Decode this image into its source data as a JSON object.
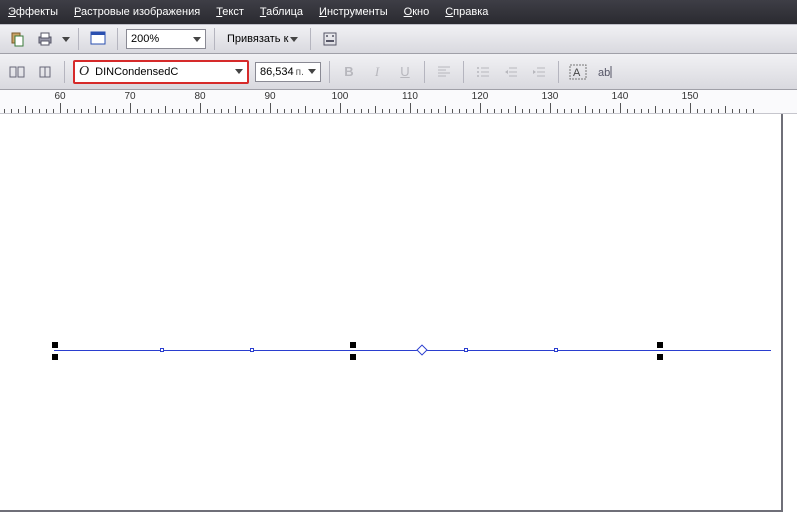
{
  "menu": {
    "effects": {
      "u": "Э",
      "rest": "ффекты"
    },
    "raster": {
      "u": "Р",
      "rest": "астровые изображения"
    },
    "text": {
      "u": "Т",
      "rest": "екст"
    },
    "table": {
      "u": "Т",
      "rest": "аблица"
    },
    "tools": {
      "u": "И",
      "rest": "нструменты"
    },
    "window": {
      "u": "О",
      "rest": "кно"
    },
    "help": {
      "u": "С",
      "rest": "правка"
    }
  },
  "toolbar1": {
    "zoom": "200%",
    "snap_label": "Привязать к"
  },
  "toolbar2": {
    "font_name": "DINCondensedC",
    "font_size": "86,534",
    "size_unit": "п."
  },
  "ruler": {
    "labels": [
      "60",
      "70",
      "80",
      "90",
      "100",
      "110",
      "120",
      "130",
      "140",
      "150"
    ]
  }
}
